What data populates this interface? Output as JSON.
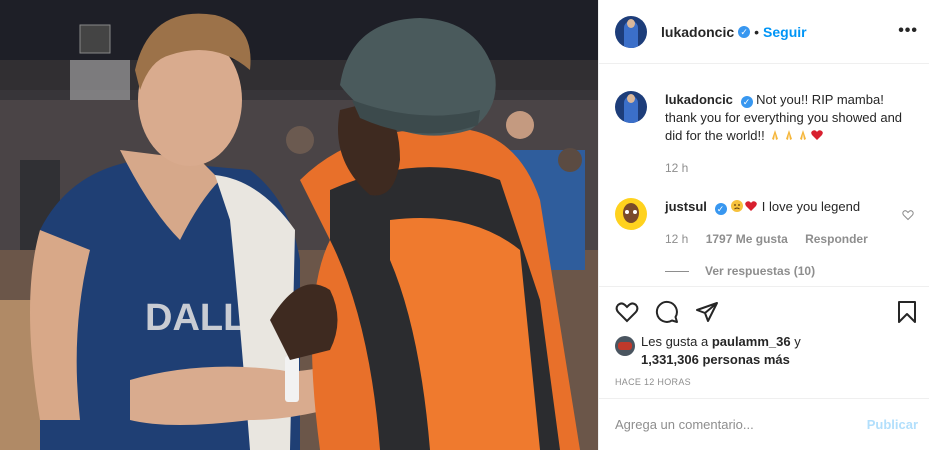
{
  "post": {
    "username": "lukadoncic",
    "follow_label": "Seguir",
    "dot": "•",
    "more_label": "•••"
  },
  "caption": {
    "username": "lukadoncic",
    "text": "Not you!! RIP mamba! thank you for everything you showed and did for the world!!",
    "emojis": [
      "folded-hands",
      "folded-hands",
      "folded-hands",
      "red-heart"
    ],
    "time": "12 h"
  },
  "comment": {
    "username": "justsul",
    "emojis": [
      "sad-face",
      "red-heart"
    ],
    "text": "I love you legend",
    "time": "12 h",
    "likes": "1797 Me gusta",
    "reply_label": "Responder",
    "view_replies": "Ver respuestas (10)"
  },
  "actions": {
    "icons": [
      "heart-icon",
      "comment-icon",
      "share-icon",
      "bookmark-icon"
    ]
  },
  "likes": {
    "prefix": "Les gusta a ",
    "user": "paulamm_36",
    "connector": " y",
    "count": "1,331,306 personas más"
  },
  "timestamp": "HACE 12 HORAS",
  "add_comment": {
    "placeholder": "Agrega un comentario...",
    "publish_label": "Publicar"
  },
  "colors": {
    "accent": "#0095f6",
    "publish_disabled": "#b2dffc",
    "heart": "#ed4956"
  }
}
